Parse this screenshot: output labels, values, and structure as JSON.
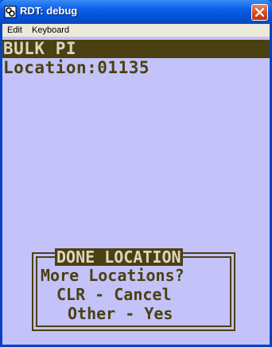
{
  "window": {
    "title": "RDT: debug",
    "accent": "#0a56d8",
    "close_icon": "close-icon"
  },
  "menu": [
    {
      "label": "Edit"
    },
    {
      "label": "Keyboard"
    }
  ],
  "screen": {
    "header": "BULK PI",
    "location_line": "Location:01135",
    "text_color": "#4b4011",
    "background": "#c3c3f9"
  },
  "dialog": {
    "title": "DONE LOCATION",
    "lines": [
      "More Locations?",
      "CLR - Cancel",
      "Other - Yes"
    ]
  }
}
